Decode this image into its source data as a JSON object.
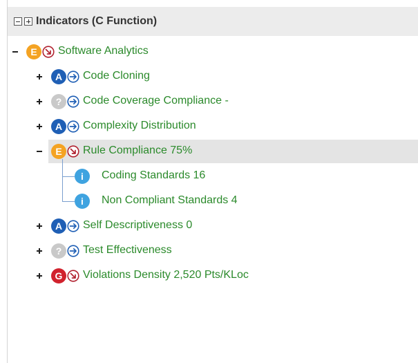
{
  "header": {
    "title": "Indicators (C Function)"
  },
  "colors": {
    "label": "#2b8a2b",
    "grade_A": "#1f5fb5",
    "grade_E": "#f4a323",
    "grade_G": "#d1222d",
    "grade_unknown": "#c9c9c9",
    "info": "#3fa3e0",
    "arrow_right": "#1f5fb5",
    "arrow_down": "#b12230"
  },
  "tree": {
    "root": {
      "label": "Software Analytics",
      "grade": "E",
      "trend": "down",
      "expanded": true
    },
    "children": [
      {
        "label": "Code Cloning",
        "grade": "A",
        "trend": "right",
        "expanded": false
      },
      {
        "label": "Code Coverage Compliance -",
        "grade": "?",
        "trend": "right",
        "expanded": false
      },
      {
        "label": "Complexity Distribution",
        "grade": "A",
        "trend": "right",
        "expanded": false
      },
      {
        "label": "Rule Compliance 75%",
        "grade": "E",
        "trend": "down",
        "expanded": true,
        "selected": true,
        "children": [
          {
            "label": "Coding Standards 16",
            "grade": "i"
          },
          {
            "label": "Non Compliant Standards 4",
            "grade": "i"
          }
        ]
      },
      {
        "label": "Self Descriptiveness 0",
        "grade": "A",
        "trend": "right",
        "expanded": false
      },
      {
        "label": "Test Effectiveness",
        "grade": "?",
        "trend": "right",
        "expanded": false
      },
      {
        "label": "Violations Density 2,520 Pts/KLoc",
        "grade": "G",
        "trend": "down",
        "expanded": false
      }
    ]
  }
}
